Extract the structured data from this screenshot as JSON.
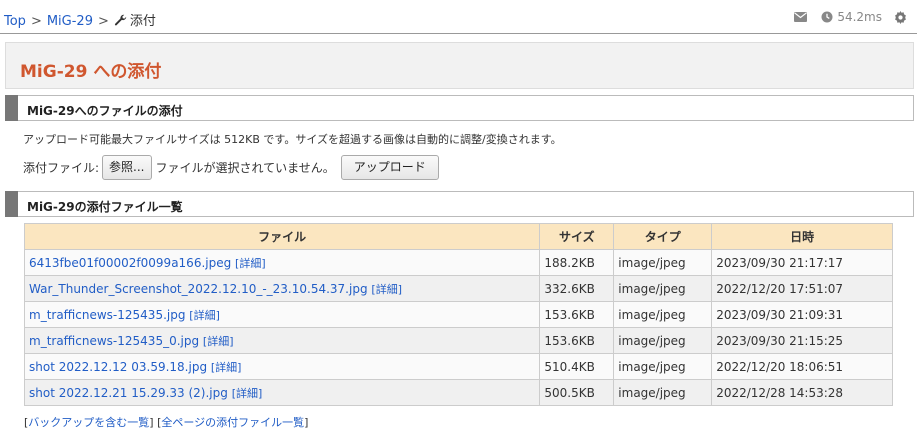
{
  "breadcrumb": {
    "top": "Top",
    "sep": ">",
    "page": "MiG-29",
    "current": "添付"
  },
  "topright": {
    "timing": "54.2ms",
    "icons": [
      "mail-icon",
      "clock-icon",
      "gear-icon"
    ]
  },
  "title": "MiG-29 への添付",
  "upload_section": {
    "heading": "MiG-29へのファイルの添付",
    "note": "アップロード可能最大ファイルサイズは 512KB です。サイズを超過する画像は自動的に調整/変換されます。",
    "file_label": "添付ファイル:",
    "browse_button": "参照...",
    "no_file_text": "ファイルが選択されていません。",
    "upload_button": "アップロード"
  },
  "list_section": {
    "heading": "MiG-29の添付ファイル一覧",
    "columns": [
      "ファイル",
      "サイズ",
      "タイプ",
      "日時"
    ],
    "detail_label": "[詳細]",
    "rows": [
      {
        "name": "6413fbe01f00002f0099a166.jpeg",
        "size": "188.2KB",
        "type": "image/jpeg",
        "date": "2023/09/30 21:17:17"
      },
      {
        "name": "War_Thunder_Screenshot_2022.12.10_-_23.10.54.37.jpg",
        "size": "332.6KB",
        "type": "image/jpeg",
        "date": "2022/12/20 17:51:07"
      },
      {
        "name": "m_trafficnews-125435.jpg",
        "size": "153.6KB",
        "type": "image/jpeg",
        "date": "2023/09/30 21:09:31"
      },
      {
        "name": "m_trafficnews-125435_0.jpg",
        "size": "153.6KB",
        "type": "image/jpeg",
        "date": "2023/09/30 21:15:25"
      },
      {
        "name": "shot 2022.12.12 03.59.18.jpg",
        "size": "510.4KB",
        "type": "image/jpeg",
        "date": "2022/12/20 18:06:51"
      },
      {
        "name": "shot 2022.12.21 15.29.33 (2).jpg",
        "size": "500.5KB",
        "type": "image/jpeg",
        "date": "2022/12/28 14:53:28"
      }
    ]
  },
  "bottom_links": {
    "backup": "バックアップを含む一覧",
    "all_pages": "全ページの添付ファイル一覧"
  },
  "colors": {
    "title": "#d0572f",
    "link": "#215dc6",
    "table_header": "#fbe6c0",
    "section_bar": "#777777"
  }
}
